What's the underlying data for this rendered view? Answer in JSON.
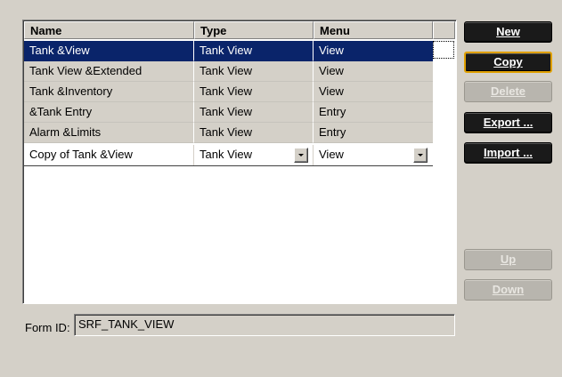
{
  "grid": {
    "headers": [
      "Name",
      "Type",
      "Menu"
    ],
    "rows": [
      {
        "name": "Tank &View",
        "type": "Tank View",
        "menu": "View"
      },
      {
        "name": "Tank View &Extended",
        "type": "Tank View",
        "menu": "View"
      },
      {
        "name": "Tank &Inventory",
        "type": "Tank View",
        "menu": "View"
      },
      {
        "name": "&Tank Entry",
        "type": "Tank View",
        "menu": "Entry"
      },
      {
        "name": "Alarm &Limits",
        "type": "Tank View",
        "menu": "Entry"
      },
      {
        "name": "Copy of Tank &View",
        "type": "Tank View",
        "menu": "View"
      }
    ]
  },
  "buttons": {
    "new": "New",
    "copy": "Copy",
    "delete": "Delete",
    "export": "Export ...",
    "import": "Import ...",
    "up": "Up",
    "down": "Down"
  },
  "form_id": {
    "label": "Form ID:",
    "value": "SRF_TANK_VIEW"
  },
  "colors": {
    "selection": "#0a246a",
    "dialog_bg": "#d4d0c8",
    "button_bg": "#1a1a1a",
    "focus_ring": "#e0a000"
  }
}
